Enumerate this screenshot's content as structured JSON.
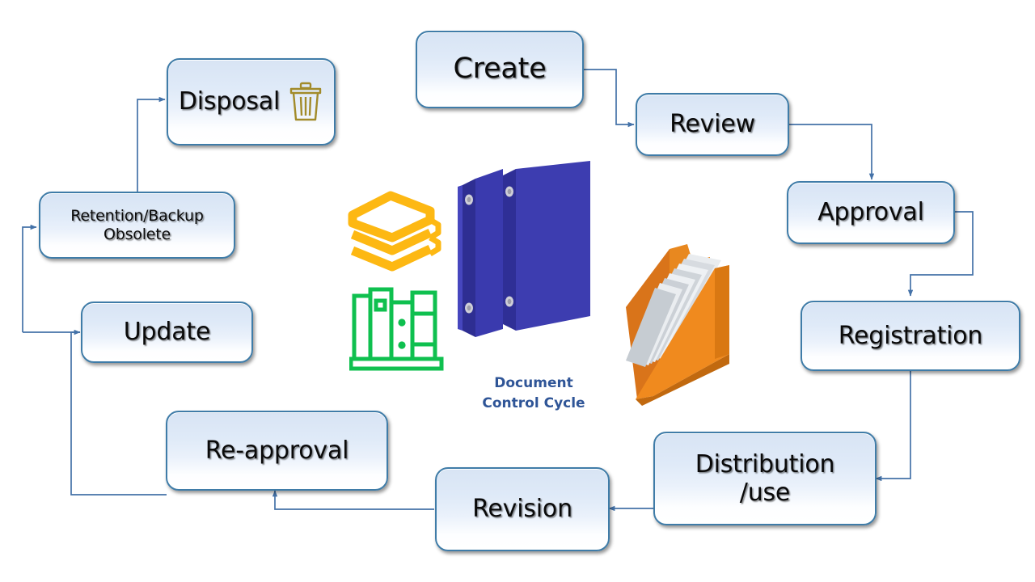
{
  "diagram": {
    "center_caption": "Document\nControl Cycle",
    "accent_color": "#2F5597",
    "box_border_color": "#3F7CA8",
    "box_fill_top": "#D8E4F4",
    "box_fill_bottom": "#FFFFFF",
    "connector_color": "#4472A8",
    "nodes": [
      {
        "id": "create",
        "label": "Create"
      },
      {
        "id": "review",
        "label": "Review"
      },
      {
        "id": "approval",
        "label": "Approval"
      },
      {
        "id": "registration",
        "label": "Registration"
      },
      {
        "id": "distribution",
        "label": "Distribution\n/use"
      },
      {
        "id": "revision",
        "label": "Revision"
      },
      {
        "id": "reapproval",
        "label": "Re-approval"
      },
      {
        "id": "update",
        "label": "Update"
      },
      {
        "id": "retention",
        "label": "Retention/Backup\nObsolete"
      },
      {
        "id": "disposal",
        "label": "Disposal"
      }
    ],
    "icons": {
      "disposal_icon": "trash-icon",
      "binders": "blue-ring-binders",
      "books_stack": "yellow-book-stack-icon",
      "shelf": "green-bookshelf-icon",
      "folder": "orange-folder-with-pages"
    },
    "flow": [
      "Create → Review",
      "Review → Approval",
      "Approval → Registration",
      "Registration → Distribution/use",
      "Distribution/use → Revision",
      "Revision → Re-approval",
      "Re-approval → Update",
      "Update → Retention/Backup Obsolete",
      "Retention/Backup Obsolete → Disposal"
    ]
  }
}
